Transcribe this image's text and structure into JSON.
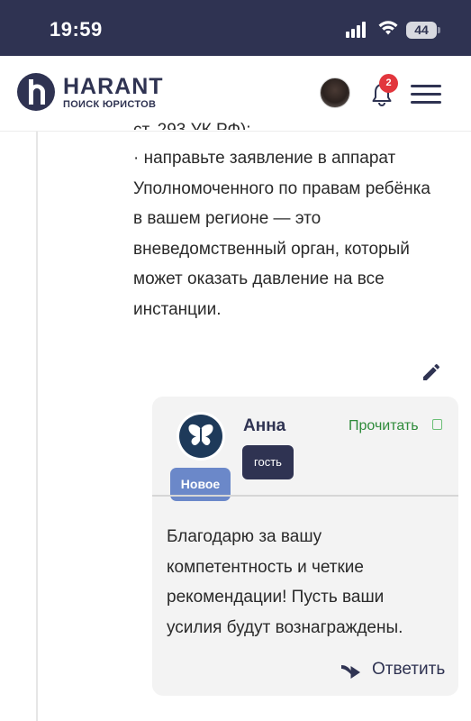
{
  "status_bar": {
    "time": "19:59",
    "battery": "44"
  },
  "header": {
    "logo_title": "HARANT",
    "logo_subtitle": "ПОИСК ЮРИСТОВ",
    "notification_count": "2"
  },
  "answer": {
    "cut_line": "ст. 293 УК РФ);",
    "paragraph": "· направьте заявление в аппарат Уполномоченного по правам ребёнка в вашем регионе — это вневедомственный орган, который может оказать давление на все инстанции."
  },
  "comment": {
    "badge_new": "Новое",
    "author": "Анна",
    "role": "гость",
    "read_label": "Прочитать",
    "text": "Благодарю за вашу компетентность и четкие рекомендации! Пусть ваши усилия будут вознаграждены.",
    "reply_label": "Ответить"
  },
  "colors": {
    "brand": "#2f3352",
    "new_badge": "#6b88c9",
    "read_green": "#2e8b3a",
    "notification_red": "#e2363d"
  },
  "icons": {
    "edit": "pencil-icon",
    "reply": "reply-arrow-icon",
    "notifications": "bell-icon",
    "menu": "hamburger-icon",
    "avatar_comment": "butterfly-icon"
  }
}
